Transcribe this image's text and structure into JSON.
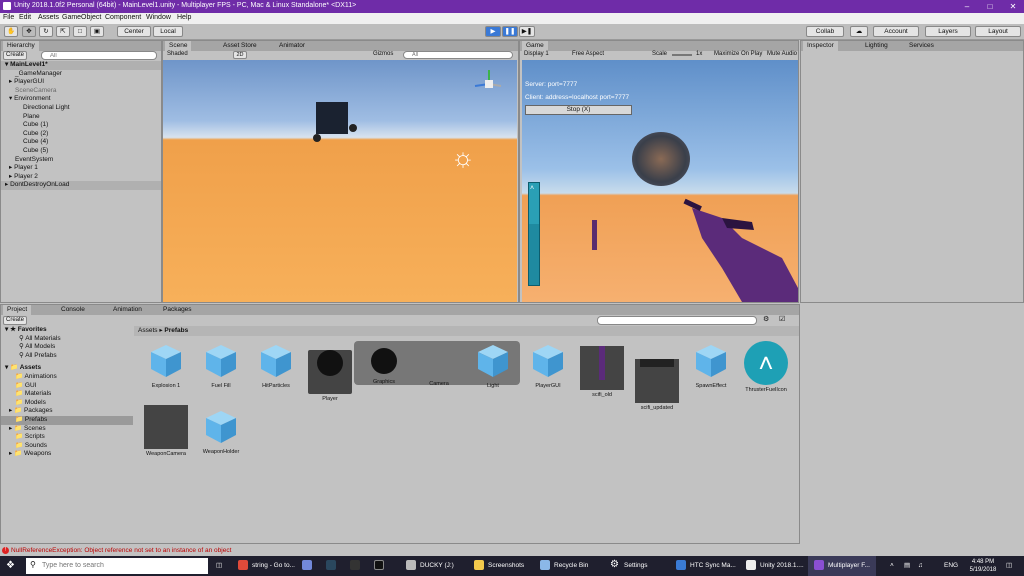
{
  "window": {
    "title": "Unity 2018.1.0f2 Personal (64bit) - MainLevel1.unity - Multiplayer FPS - PC, Mac & Linux Standalone* <DX11>"
  },
  "menu": [
    "File",
    "Edit",
    "Assets",
    "GameObject",
    "Component",
    "Window",
    "Help"
  ],
  "toolbar": {
    "center": "Center",
    "local": "Local",
    "collab": "Collab",
    "account": "Account",
    "layers": "Layers",
    "layout": "Layout"
  },
  "hierarchy": {
    "tab": "Hierarchy",
    "create": "Create",
    "search_placeholder": "All",
    "items": [
      "MainLevel1*",
      "_GameManager",
      "PlayerGUI",
      "SceneCamera",
      "Environment",
      "Directional Light",
      "Plane",
      "Cube (1)",
      "Cube (2)",
      "Cube (4)",
      "Cube (5)",
      "EventSystem",
      "Player 1",
      "Player 2",
      "DontDestroyOnLoad"
    ]
  },
  "scene": {
    "tabs": [
      "Scene",
      "Asset Store",
      "Animator"
    ],
    "shaded": "Shaded",
    "mode": "2D",
    "gizmos": "Gizmos",
    "search_placeholder": "All"
  },
  "game": {
    "tab": "Game",
    "display": "Display 1",
    "aspect": "Free Aspect",
    "scale": "1x",
    "maximize": "Maximize On Play",
    "mute": "Mute Audio",
    "server": "Server: port=7777",
    "client": "Client: address=localhost port=7777",
    "stop": "Stop (X)",
    "fuel_level": 0.6
  },
  "inspector": {
    "tabs": [
      "Inspector",
      "Lighting",
      "Services"
    ]
  },
  "project": {
    "tabs": [
      "Project",
      "Console",
      "Animation",
      "Packages"
    ],
    "create": "Create",
    "tree": [
      {
        "label": "Favorites",
        "bold": true
      },
      {
        "label": "All Materials"
      },
      {
        "label": "All Models"
      },
      {
        "label": "All Prefabs"
      },
      {
        "label": "Assets",
        "bold": true
      },
      {
        "label": "Animations"
      },
      {
        "label": "GUI"
      },
      {
        "label": "Materials"
      },
      {
        "label": "Models"
      },
      {
        "label": "Packages"
      },
      {
        "label": "Prefabs"
      },
      {
        "label": "Scenes"
      },
      {
        "label": "Scripts"
      },
      {
        "label": "Sounds"
      },
      {
        "label": "Weapons"
      }
    ],
    "breadcrumb": [
      "Assets",
      "Prefabs"
    ],
    "prefabs": [
      "Explosion 1",
      "Fuel Fill",
      "HitParticles",
      "Player",
      "Graphics",
      "Camera",
      "Light",
      "PlayerGUI",
      "scifi_old",
      "scifi_updated",
      "SpawnEffect",
      "ThrusterFuelIcon",
      "WeaponCamera",
      "WeaponHolder"
    ]
  },
  "status": {
    "error": "NullReferenceException: Object reference not set to an instance of an object"
  },
  "taskbar": {
    "search_placeholder": "Type here to search",
    "apps": [
      "string - Go to...",
      "DUCKY (J:)",
      "Screenshots",
      "Recycle Bin",
      "Settings",
      "HTC Sync Ma...",
      "Unity 2018.1....",
      "Multiplayer F..."
    ],
    "lang": "ENG",
    "time": "4:48 PM",
    "date": "5/19/2018"
  },
  "colors": {
    "title": "#6f2ca8",
    "play": "#3a79d6",
    "cube": "#5fb4ea",
    "thruster": "#1ea0b5"
  }
}
